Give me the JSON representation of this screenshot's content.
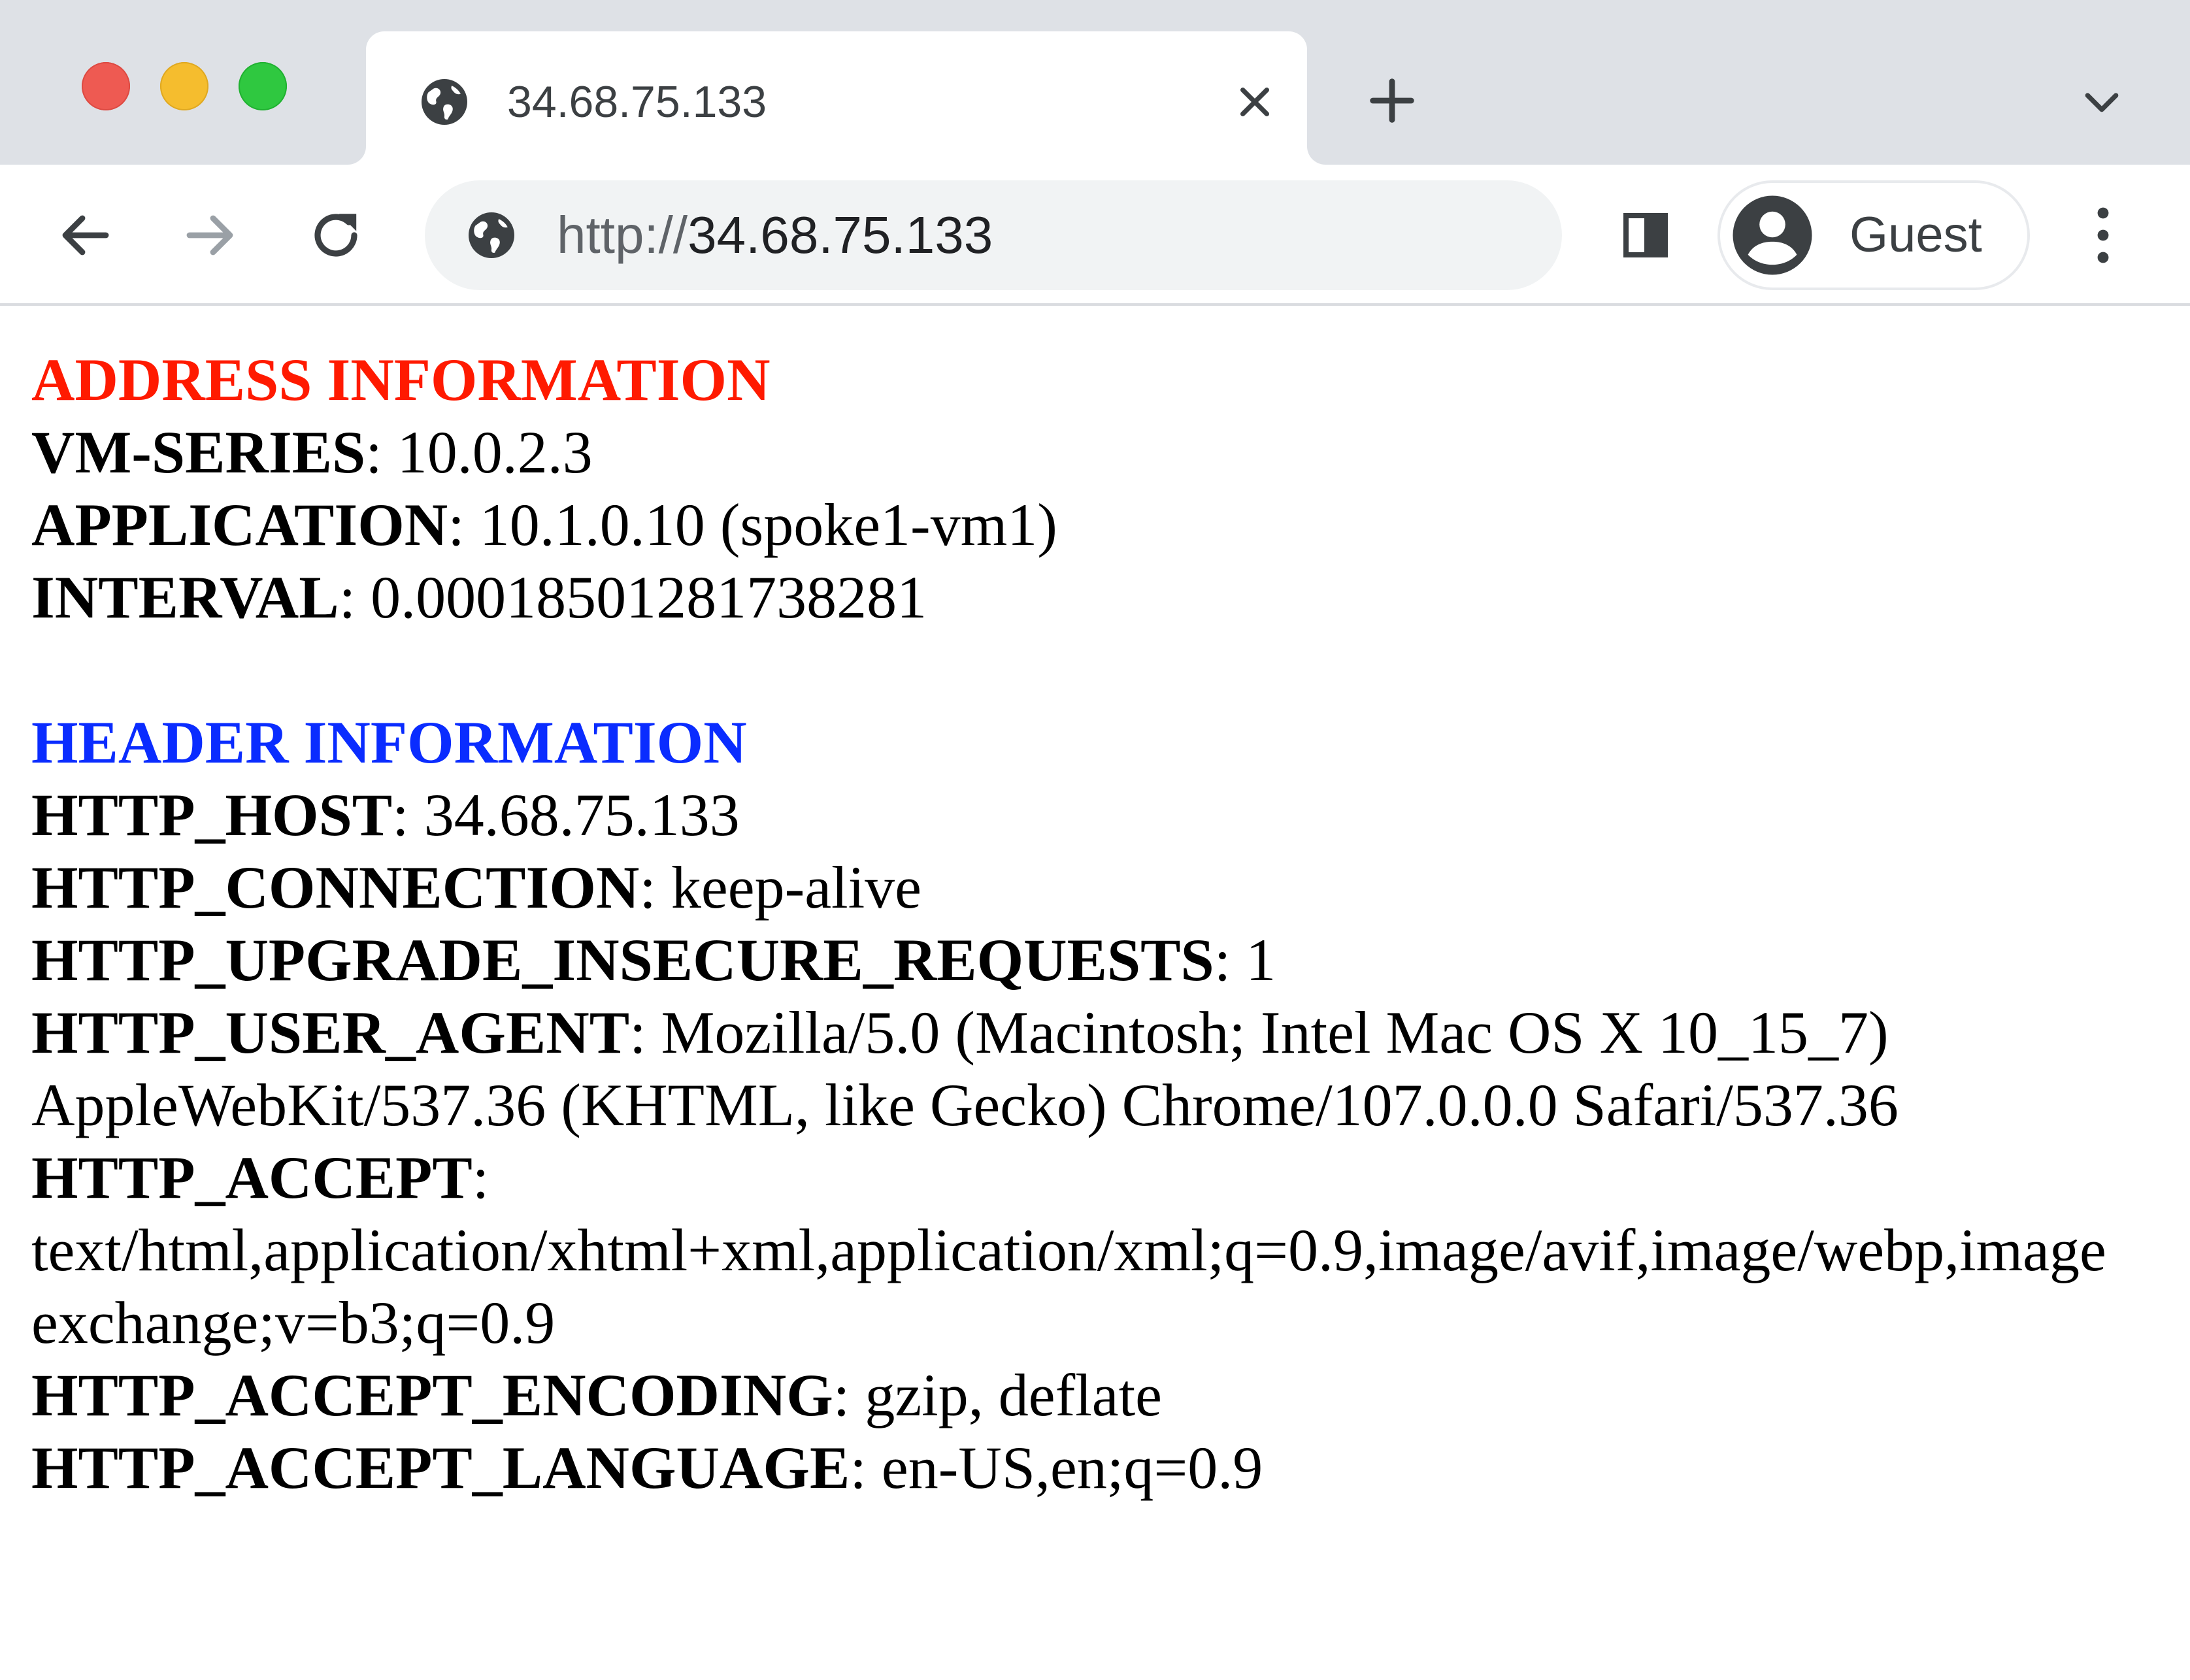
{
  "browser": {
    "tab_title": "34.68.75.133",
    "url_scheme": "http://",
    "url_host": "34.68.75.133",
    "profile_label": "Guest",
    "colors": {
      "tabstrip": "#dee1e6",
      "omnibox": "#f1f3f4",
      "close": "#ee5a52",
      "minimize": "#f5bd2e",
      "zoom": "#2fc840"
    },
    "icons": [
      "globe-icon",
      "close-icon",
      "plus-icon",
      "chevron-down-icon",
      "back-arrow-icon",
      "forward-arrow-icon",
      "reload-icon",
      "side-panel-icon",
      "account-icon",
      "more-vert-icon"
    ]
  },
  "page": {
    "address_section": {
      "title": "ADDRESS INFORMATION",
      "title_color": "#ff1a00",
      "rows": [
        {
          "key": "VM-SERIES",
          "value": ": 10.0.2.3"
        },
        {
          "key": "APPLICATION",
          "value": ": 10.1.0.10 (spoke1-vm1)"
        },
        {
          "key": "INTERVAL",
          "value": ": 0.00018501281738281"
        }
      ]
    },
    "header_section": {
      "title": "HEADER INFORMATION",
      "title_color": "#0a2cff",
      "http_host": {
        "key": "HTTP_HOST",
        "value": ": 34.68.75.133"
      },
      "http_connection": {
        "key": "HTTP_CONNECTION",
        "value": ": keep-alive"
      },
      "http_upgrade": {
        "key": "HTTP_UPGRADE_INSECURE_REQUESTS",
        "value": ": 1"
      },
      "http_user_agent": {
        "key": "HTTP_USER_AGENT",
        "value_line1": ": Mozilla/5.0 (Macintosh; Intel Mac OS X 10_15_7)",
        "value_line2": "AppleWebKit/537.36 (KHTML, like Gecko) Chrome/107.0.0.0 Safari/537.36"
      },
      "http_accept": {
        "key": "HTTP_ACCEPT",
        "value_line1": ":",
        "value_line2": "text/html,application/xhtml+xml,application/xml;q=0.9,image/avif,image/webp,image",
        "value_line3": "exchange;v=b3;q=0.9"
      },
      "http_accept_encoding": {
        "key": "HTTP_ACCEPT_ENCODING",
        "value": ": gzip, deflate"
      },
      "http_accept_language": {
        "key": "HTTP_ACCEPT_LANGUAGE",
        "value": ": en-US,en;q=0.9"
      }
    }
  }
}
